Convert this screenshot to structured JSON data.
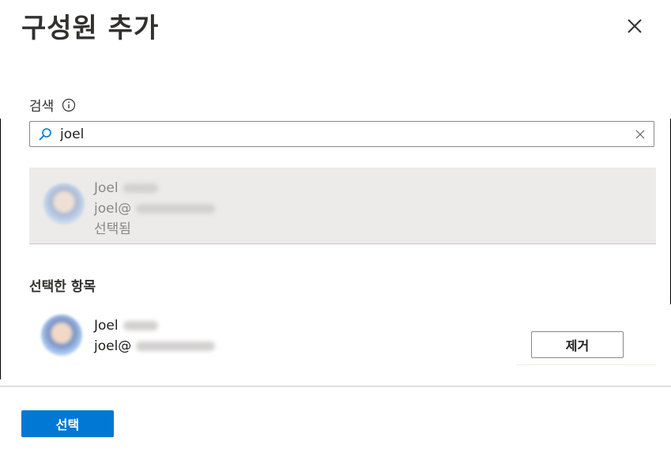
{
  "dialog": {
    "title": "구성원 추가",
    "close_icon": "close-icon"
  },
  "search": {
    "label": "검색",
    "info_icon": "info-icon",
    "search_icon": "search-icon",
    "value": "joel",
    "clear_icon": "clear-icon"
  },
  "results": [
    {
      "first_name": "Joel",
      "email_prefix": "joel@",
      "status": "선택됨"
    }
  ],
  "selected": {
    "heading": "선택한 항목",
    "items": [
      {
        "first_name": "Joel",
        "email_prefix": "joel@",
        "remove_label": "제거"
      }
    ]
  },
  "footer": {
    "select_label": "선택",
    "accent": "#0078d4"
  }
}
